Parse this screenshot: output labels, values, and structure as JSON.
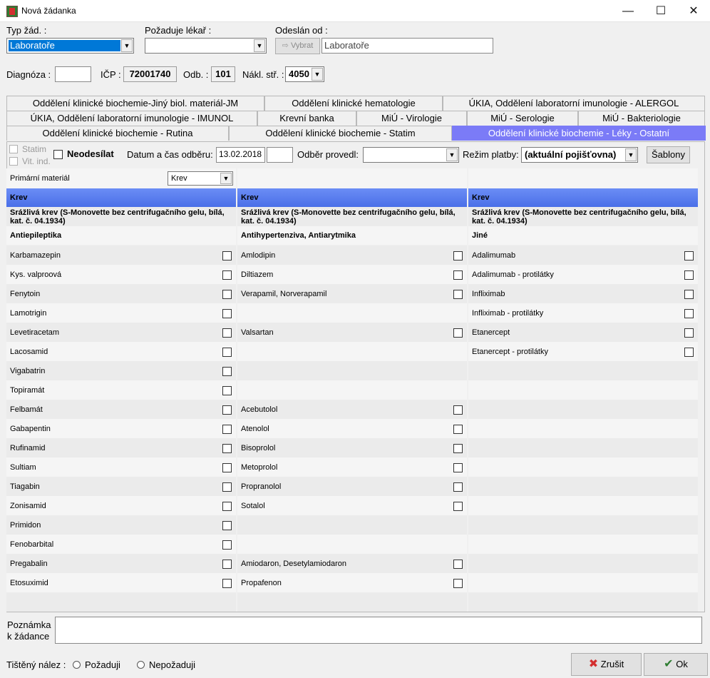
{
  "window": {
    "title": "Nová žádanka",
    "controls": {
      "minimize": "—",
      "maximize": "☐",
      "close": "✕"
    }
  },
  "top": {
    "typ_zad_label": "Typ žád. :",
    "typ_zad_value": "Laboratoře",
    "pozaduje_lekar_label": "Požaduje lékař :",
    "pozaduje_lekar_value": "",
    "odeslan_od_label": "Odeslán od :",
    "vybrat_label": "Vybrat",
    "odeslan_od_value": "Laboratoře",
    "diagnoza_label": "Diagnóza :",
    "diagnoza_value": "",
    "icp_label": "IČP :",
    "icp_value": "72001740",
    "odb_label": "Odb. :",
    "odb_value": "101",
    "nakl_label": "Nákl. stř. :",
    "nakl_value": "4050"
  },
  "tabs": {
    "row1": [
      "Oddělení klinické biochemie-Jiný biol. materiál-JM",
      "Oddělení klinické hematologie",
      "ÚKIA, Oddělení laboratorní imunologie - ALERGOL"
    ],
    "row2": [
      "ÚKIA, Oddělení laboratorní imunologie - IMUNOL",
      "Krevní banka",
      "MiÚ - Virologie",
      "MiÚ - Serologie",
      "MiÚ - Bakteriologie"
    ],
    "row3": [
      "Oddělení klinické biochemie - Rutina",
      "Oddělení klinické biochemie - Statim",
      "Oddělení klinické biochemie - Léky - Ostatní"
    ]
  },
  "options": {
    "statim": "Statim",
    "vit_ind": "Vit. ind.",
    "neodesilat": "Neodesílat",
    "datum_label": "Datum a čas odběru:",
    "datum_value": "13.02.2018",
    "cas_value": "",
    "odber_label": "Odběr provedl:",
    "odber_value": "",
    "rezim_label": "Režim platby:",
    "rezim_value": "(aktuální pojišťovna)",
    "sablony": "Šablony"
  },
  "grid": {
    "primary_material_label": "Primární materiál",
    "primary_material_value": "Krev",
    "columns": [
      {
        "material": "Krev",
        "tube": "Srážlivá krev (S-Monovette bez centrifugačního gelu, bílá, kat. č. 04.1934)",
        "group": "Antiepileptika",
        "items": [
          "Karbamazepin",
          "Kys. valproová",
          "Fenytoin",
          "Lamotrigin",
          "Levetiracetam",
          "Lacosamid",
          "Vigabatrin",
          "Topiramát",
          "Felbamát",
          "Gabapentin",
          "Rufinamid",
          "Sultiam",
          "Tiagabin",
          "Zonisamid",
          "Primidon",
          "Fenobarbital",
          "Pregabalin",
          "Etosuximid"
        ]
      },
      {
        "material": "Krev",
        "tube": "Srážlivá krev (S-Monovette bez centrifugačního gelu, bílá, kat. č. 04.1934)",
        "group": "Antihypertenziva, Antiarytmika",
        "items": [
          "Amlodipin",
          "Diltiazem",
          "Verapamil, Norverapamil",
          "",
          "Valsartan",
          "",
          "",
          "",
          "Acebutolol",
          "Atenolol",
          "Bisoprolol",
          "Metoprolol",
          "Propranolol",
          "Sotalol",
          "",
          "",
          "Amiodaron, Desetylamiodaron",
          "Propafenon"
        ]
      },
      {
        "material": "Krev",
        "tube": "Srážlivá krev (S-Monovette bez centrifugačního gelu, bílá, kat. č. 04.1934)",
        "group": "Jiné",
        "items": [
          "Adalimumab",
          "Adalimumab - protilátky",
          "Infliximab",
          "Infliximab - protilátky",
          "Etanercept",
          "Etanercept - protilátky",
          "",
          "",
          "",
          "",
          "",
          "",
          "",
          "",
          "",
          "",
          "",
          ""
        ]
      }
    ]
  },
  "note": {
    "label_line1": "Poznámka",
    "label_line2": "k žádance",
    "value": ""
  },
  "footer": {
    "tisteny_label": "Tištěný nález :",
    "pozaduji": "Požaduji",
    "nepozaduji": "Nepožaduji",
    "zrusit": "Zrušit",
    "ok": "Ok"
  }
}
